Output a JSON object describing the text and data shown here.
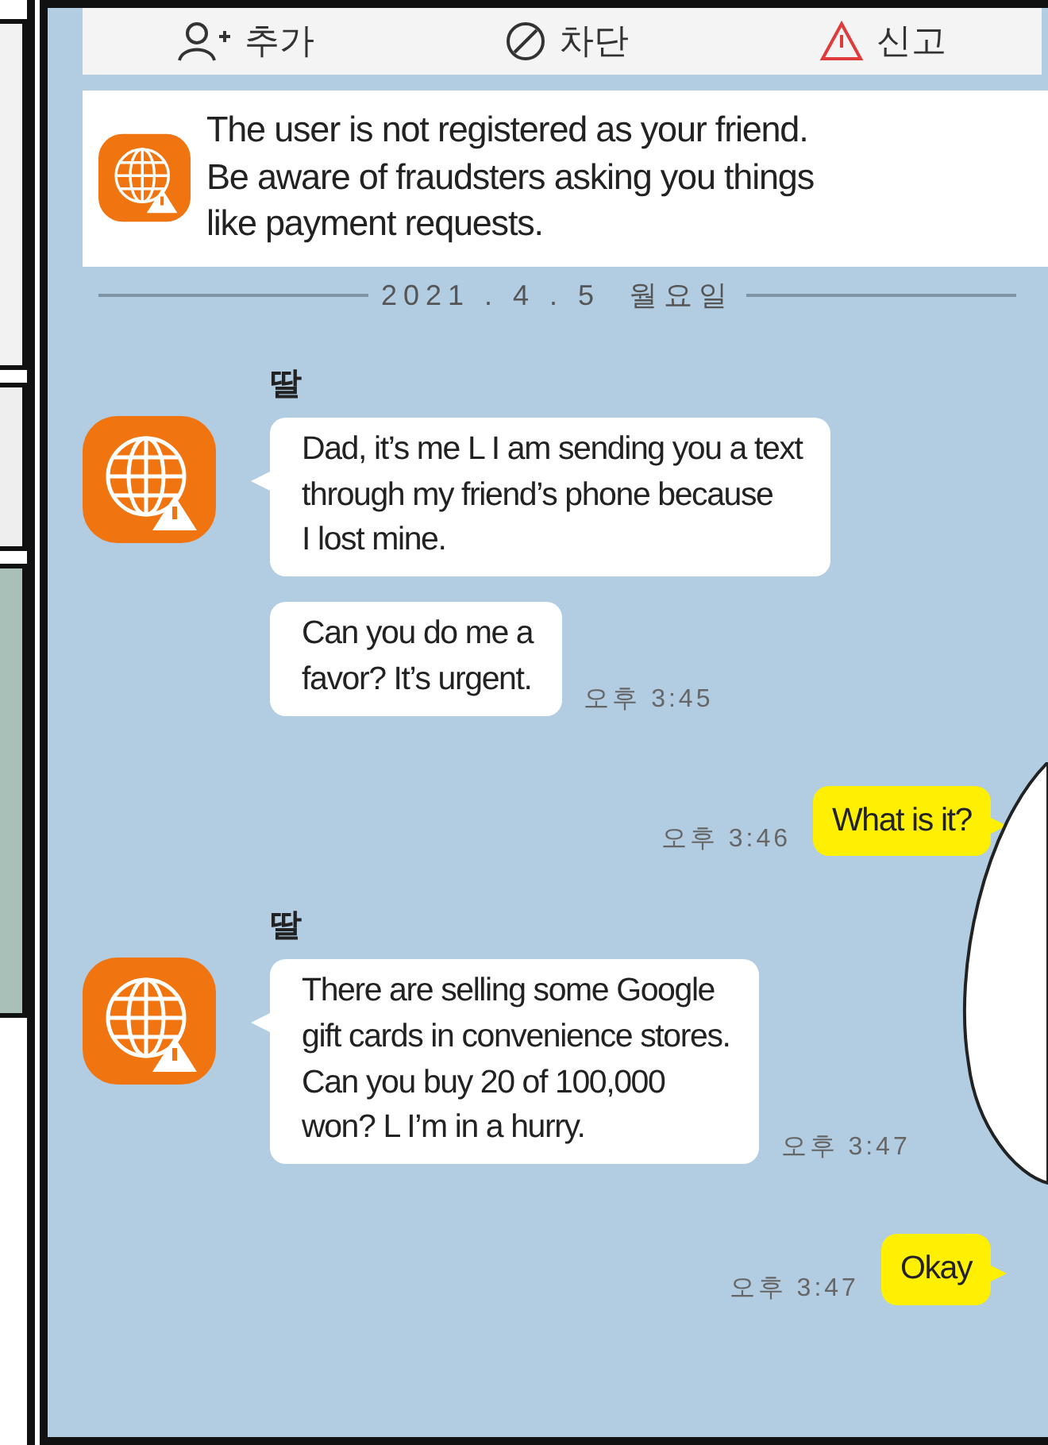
{
  "toolbar": {
    "buttons": [
      {
        "kind": "add",
        "label": "추가"
      },
      {
        "kind": "block",
        "label": "차단"
      },
      {
        "kind": "report",
        "label": "신고"
      }
    ]
  },
  "notice": {
    "text": "The user is not registered as your friend.\nBe aware of fraudsters asking you things\nlike payment requests."
  },
  "date_divider": "2021 . 4 . 5  월요일",
  "messages": [
    {
      "kind": "received",
      "sender": "딸",
      "bubbles": [
        "Dad, it’s me L I am sending you a text\nthrough my friend’s phone because\nI lost mine.",
        "Can you do me a\nfavor? It’s urgent."
      ],
      "time": "오후 3:45"
    },
    {
      "kind": "sent",
      "bubbles": [
        "What is it?"
      ],
      "time": "오후 3:46"
    },
    {
      "kind": "received",
      "sender": "딸",
      "bubbles": [
        "There are selling some Google\ngift cards in convenience stores.\nCan you buy 20 of 100,000\nwon? L I’m in a hurry."
      ],
      "time": "오후 3:47"
    },
    {
      "kind": "sent",
      "bubbles": [
        "Okay"
      ],
      "time": "오후 3:47"
    }
  ]
}
